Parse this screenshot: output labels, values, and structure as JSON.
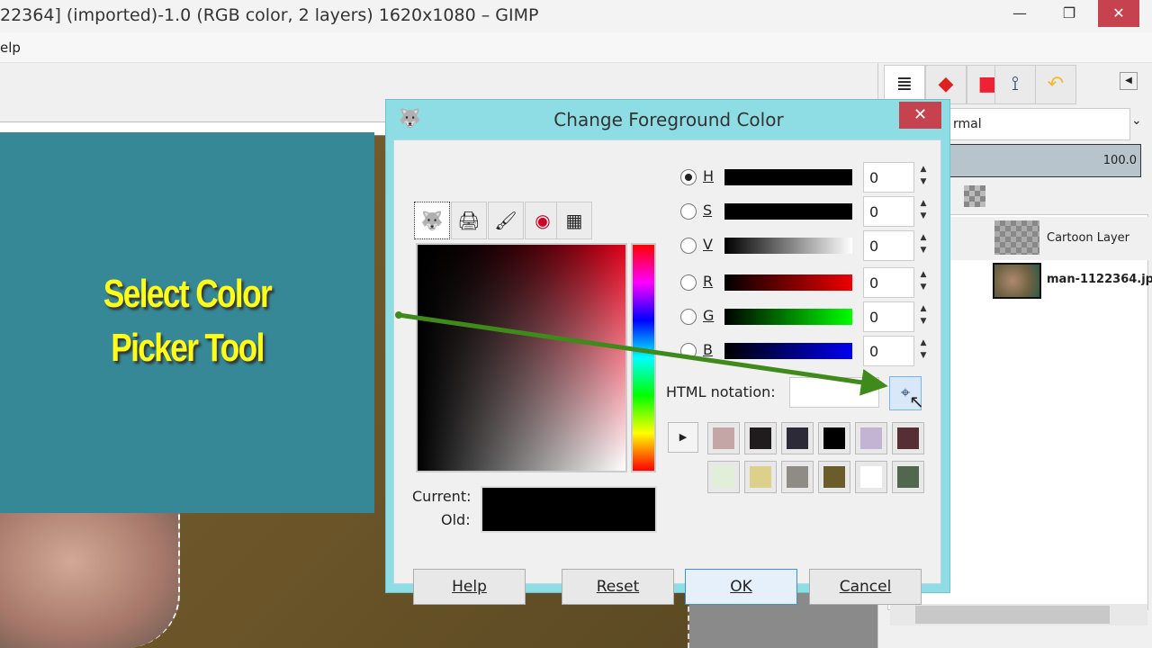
{
  "window": {
    "title": "22364] (imported)-1.0 (RGB color, 2 layers) 1620x1080 – GIMP",
    "minimize": "—",
    "restore": "❐",
    "close": "✕"
  },
  "menu": {
    "help": "elp"
  },
  "overlay": {
    "line1": "Select Color",
    "line2": "Picker Tool"
  },
  "layers_panel": {
    "mode": "rmal",
    "opacity": "100.0",
    "layers": [
      {
        "name": "Cartoon Layer"
      },
      {
        "name": "man-1122364.jp"
      }
    ]
  },
  "dialog": {
    "title": "Change Foreground Color",
    "close": "✕",
    "channels": [
      {
        "label": "H",
        "value": "0",
        "selected": true
      },
      {
        "label": "S",
        "value": "0"
      },
      {
        "label": "V",
        "value": "0"
      },
      {
        "label": "R",
        "value": "0"
      },
      {
        "label": "G",
        "value": "0"
      },
      {
        "label": "B",
        "value": "0"
      }
    ],
    "html_notation_label": "HTML notation:",
    "html_notation_value": "",
    "current_label": "Current:",
    "old_label": "Old:",
    "current_color": "#000000",
    "history": [
      "#c4a6a6",
      "#201c1e",
      "#2c2a36",
      "#000000",
      "#c3b4d4",
      "#562e36",
      "#e2efd8",
      "#dcd08a",
      "#8e8c84",
      "#6b5c2c",
      "#ffffff",
      "#52684e"
    ],
    "buttons": {
      "help": "Help",
      "reset": "Reset",
      "ok": "OK",
      "cancel": "Cancel"
    }
  },
  "colors": {
    "accent_arrow": "#3f8a1a",
    "dialog_border": "#8fdde4",
    "overlay": "#368896",
    "caption": "#ffff1a"
  }
}
